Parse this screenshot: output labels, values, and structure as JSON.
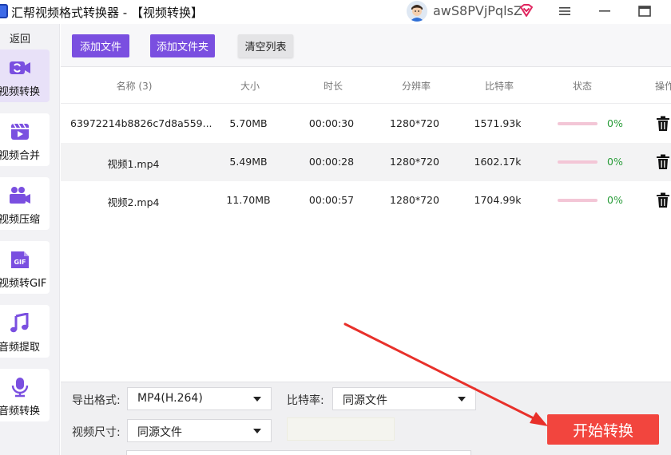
{
  "window": {
    "title": "汇帮视频格式转换器  - 【视频转换】",
    "username": "awS8PVjPqlsZ",
    "controls": {
      "menu_icon": "menu-icon",
      "minimize_icon": "minimize-icon",
      "maximize_icon": "maximize-icon"
    }
  },
  "sidebar": {
    "back_label": "返回",
    "items": [
      {
        "label": "视频转换",
        "icon": "video-convert-icon",
        "active": true
      },
      {
        "label": "视频合并",
        "icon": "video-merge-icon",
        "active": false
      },
      {
        "label": "视频压缩",
        "icon": "video-compress-icon",
        "active": false
      },
      {
        "label": "视频转GIF",
        "icon": "gif-icon",
        "active": false
      },
      {
        "label": "音频提取",
        "icon": "music-note-icon",
        "active": false
      },
      {
        "label": "音频转换",
        "icon": "microphone-icon",
        "active": false
      }
    ],
    "gif_badge": "GIF"
  },
  "toolbar": {
    "add_file": "添加文件",
    "add_folder": "添加文件夹",
    "clear_list": "清空列表"
  },
  "table": {
    "headers": {
      "name": "名称 (3)",
      "size": "大小",
      "duration": "时长",
      "resolution": "分辨率",
      "bitrate": "比特率",
      "status": "状态",
      "action": "操作"
    },
    "rows": [
      {
        "name": "63972214b8826c7d8a559...",
        "size": "5.70MB",
        "duration": "00:00:30",
        "resolution": "1280*720",
        "bitrate": "1571.93k",
        "progress": 0,
        "progress_label": "0%"
      },
      {
        "name": "视频1.mp4",
        "size": "5.49MB",
        "duration": "00:00:28",
        "resolution": "1280*720",
        "bitrate": "1602.17k",
        "progress": 0,
        "progress_label": "0%"
      },
      {
        "name": "视频2.mp4",
        "size": "11.70MB",
        "duration": "00:00:57",
        "resolution": "1280*720",
        "bitrate": "1704.99k",
        "progress": 0,
        "progress_label": "0%"
      }
    ]
  },
  "settings": {
    "format_label": "导出格式:",
    "format_value": "MP4(H.264)",
    "bitrate_label": "比特率:",
    "bitrate_value": "同源文件",
    "size_label": "视频尺寸:",
    "size_value": "同源文件"
  },
  "start_button": "开始转换",
  "colors": {
    "accent": "#7a4fe0",
    "start": "#f2453e",
    "progress": "#e66a94",
    "percent": "#2a9d3a",
    "arrow": "#e8302a"
  }
}
